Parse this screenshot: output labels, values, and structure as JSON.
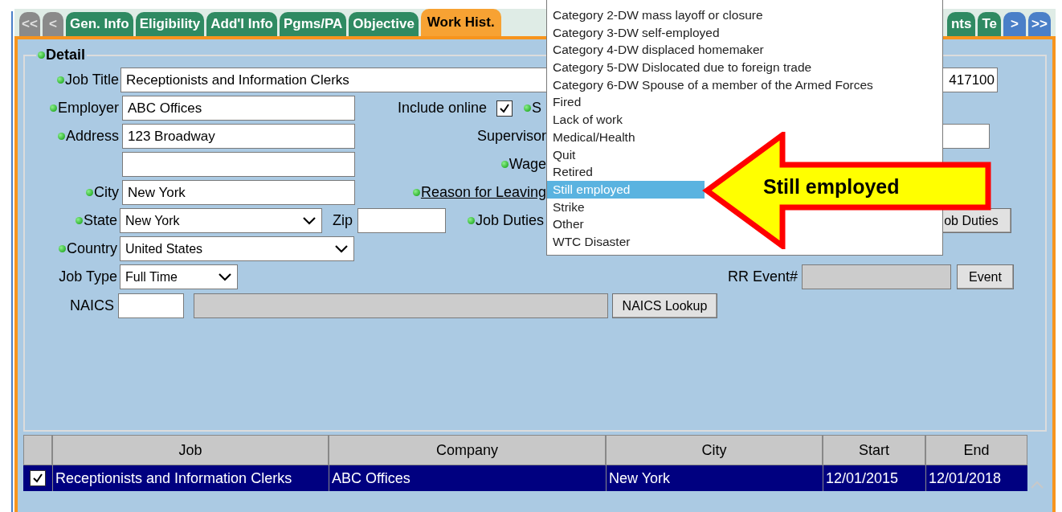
{
  "tabs": [
    {
      "label": "<<",
      "kind": "nav",
      "disabled": true,
      "selected": false
    },
    {
      "label": "<",
      "kind": "nav",
      "disabled": true,
      "selected": false
    },
    {
      "label": "Gen. Info",
      "kind": "tab",
      "selected": false
    },
    {
      "label": "Eligibility",
      "kind": "tab",
      "selected": false
    },
    {
      "label": "Add'l Info",
      "kind": "tab",
      "selected": false
    },
    {
      "label": "Pgms/PA",
      "kind": "tab",
      "selected": false
    },
    {
      "label": "Objective",
      "kind": "tab",
      "selected": false
    },
    {
      "label": "Work Hist.",
      "kind": "tab",
      "selected": true
    }
  ],
  "tabs_right": [
    {
      "label": "nts",
      "kind": "tab",
      "selected": false
    },
    {
      "label": "Te",
      "kind": "tab",
      "selected": false
    },
    {
      "label": ">",
      "kind": "nav",
      "disabled": false,
      "selected": false
    },
    {
      "label": ">>",
      "kind": "nav",
      "disabled": false,
      "selected": false
    }
  ],
  "detail": {
    "title": "Detail",
    "required": true,
    "job_title": {
      "label": "Job Title",
      "required": true,
      "value": "Receptionists and Information Clerks"
    },
    "code": {
      "value": "417100"
    },
    "employer": {
      "label": "Employer",
      "required": true,
      "value": "ABC Offices"
    },
    "include_online": {
      "label": "Include online",
      "checked": true
    },
    "s_field": {
      "label": "S",
      "required": true
    },
    "address": {
      "label": "Address",
      "required": true,
      "value": "123 Broadway"
    },
    "supervisor": {
      "label": "Supervisor"
    },
    "wage": {
      "label": "Wage",
      "required": true
    },
    "city": {
      "label": "City",
      "required": true,
      "value": "New York"
    },
    "reason": {
      "label": "Reason for Leaving",
      "required": true
    },
    "state": {
      "label": "State",
      "required": true,
      "value": "New York"
    },
    "zip": {
      "label": "Zip"
    },
    "job_duties": {
      "label": "Job Duties",
      "required": true,
      "button": "ob Duties"
    },
    "country": {
      "label": "Country",
      "required": true,
      "value": "United States"
    },
    "job_type": {
      "label": "Job Type",
      "value": "Full Time"
    },
    "rr_event": {
      "label": "RR Event#",
      "button": "Event"
    },
    "naics": {
      "label": "NAICS",
      "button": "NAICS Lookup"
    }
  },
  "reason_dropdown": {
    "options": [
      {
        "label": "Category 2-DW mass layoff or closure",
        "selected": false
      },
      {
        "label": "Category 3-DW self-employed",
        "selected": false
      },
      {
        "label": "Category 4-DW displaced homemaker",
        "selected": false
      },
      {
        "label": "Category 5-DW Dislocated due to foreign trade",
        "selected": false
      },
      {
        "label": "Category 6-DW Spouse of a member of the Armed Forces",
        "selected": false
      },
      {
        "label": "Fired",
        "selected": false
      },
      {
        "label": "Lack of work",
        "selected": false
      },
      {
        "label": "Medical/Health",
        "selected": false
      },
      {
        "label": "Quit",
        "selected": false
      },
      {
        "label": "Retired",
        "selected": false
      },
      {
        "label": "Still employed",
        "selected": true
      },
      {
        "label": "Strike",
        "selected": false
      },
      {
        "label": "Other",
        "selected": false
      },
      {
        "label": "WTC Disaster",
        "selected": false
      }
    ]
  },
  "callout": {
    "text": "Still employed"
  },
  "table": {
    "columns": [
      "Job",
      "Company",
      "City",
      "Start",
      "End"
    ],
    "rows": [
      {
        "checked": true,
        "selected": true,
        "cells": [
          "Receptionists and Information Clerks",
          "ABC Offices",
          "New York",
          "12/01/2015",
          "12/01/2018"
        ]
      }
    ]
  }
}
